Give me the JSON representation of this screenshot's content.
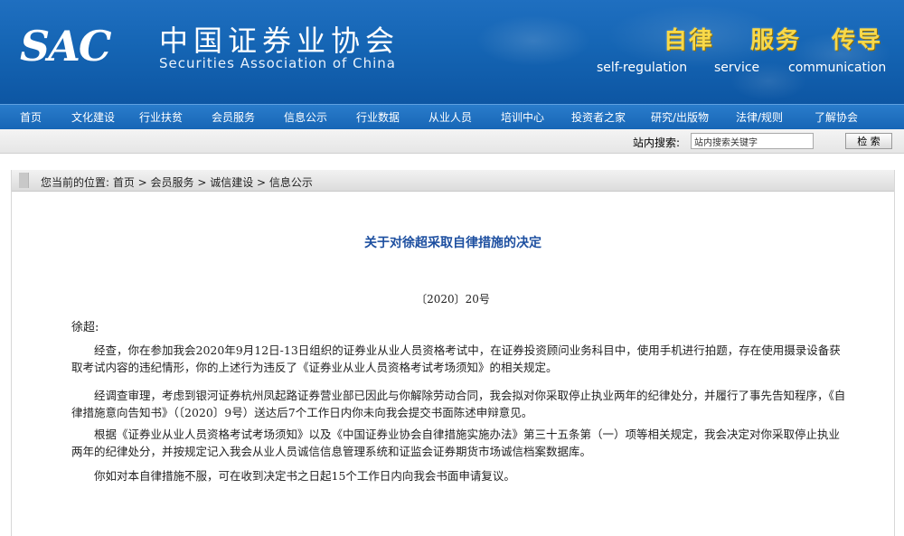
{
  "header": {
    "logo_text": "SAC",
    "org_name_cn": "中国证券业协会",
    "org_name_en": "Securities Association of China",
    "slogans": [
      {
        "cn": "自律",
        "en": "self-regulation"
      },
      {
        "cn": "服务",
        "en": "service"
      },
      {
        "cn": "传导",
        "en": "communication"
      }
    ]
  },
  "nav": {
    "items": [
      "首页",
      "文化建设",
      "行业扶贫",
      "会员服务",
      "信息公示",
      "行业数据",
      "从业人员",
      "培训中心",
      "投资者之家",
      "研究/出版物",
      "法律/规则",
      "了解协会"
    ]
  },
  "search": {
    "label": "站内搜索:",
    "value": "站内搜索关键字",
    "button": "检 索"
  },
  "breadcrumb": "您当前的位置: 首页 > 会员服务 > 诚信建设 > 信息公示",
  "document": {
    "title": "关于对徐超采取自律措施的决定",
    "number": "〔2020〕20号",
    "salutation": "徐超:",
    "paragraphs": [
      "经查，你在参加我会2020年9月12日-13日组织的证券业从业人员资格考试中，在证券投资顾问业务科目中，使用手机进行拍题，存在使用摄录设备获取考试内容的违纪情形，你的上述行为违反了《证券业从业人员资格考试考场须知》的相关规定。",
      "经调查审理，考虑到银河证券杭州凤起路证券营业部已因此与你解除劳动合同，我会拟对你采取停止执业两年的纪律处分，并履行了事先告知程序，《自律措施意向告知书》（〔2020〕9号）送达后7个工作日内你未向我会提交书面陈述申辩意见。",
      "根据《证券业从业人员资格考试考场须知》以及《中国证券业协会自律措施实施办法》第三十五条第（一）项等相关规定，我会决定对你采取停止执业两年的纪律处分，并按规定记入我会从业人员诚信信息管理系统和证监会证券期货市场诚信档案数据库。",
      "你如对本自律措施不服，可在收到决定书之日起15个工作日内向我会书面申请复议。"
    ]
  },
  "colors": {
    "banner": "#1565b4",
    "slogan": "#f8d94a",
    "title": "#1d4fa0"
  }
}
